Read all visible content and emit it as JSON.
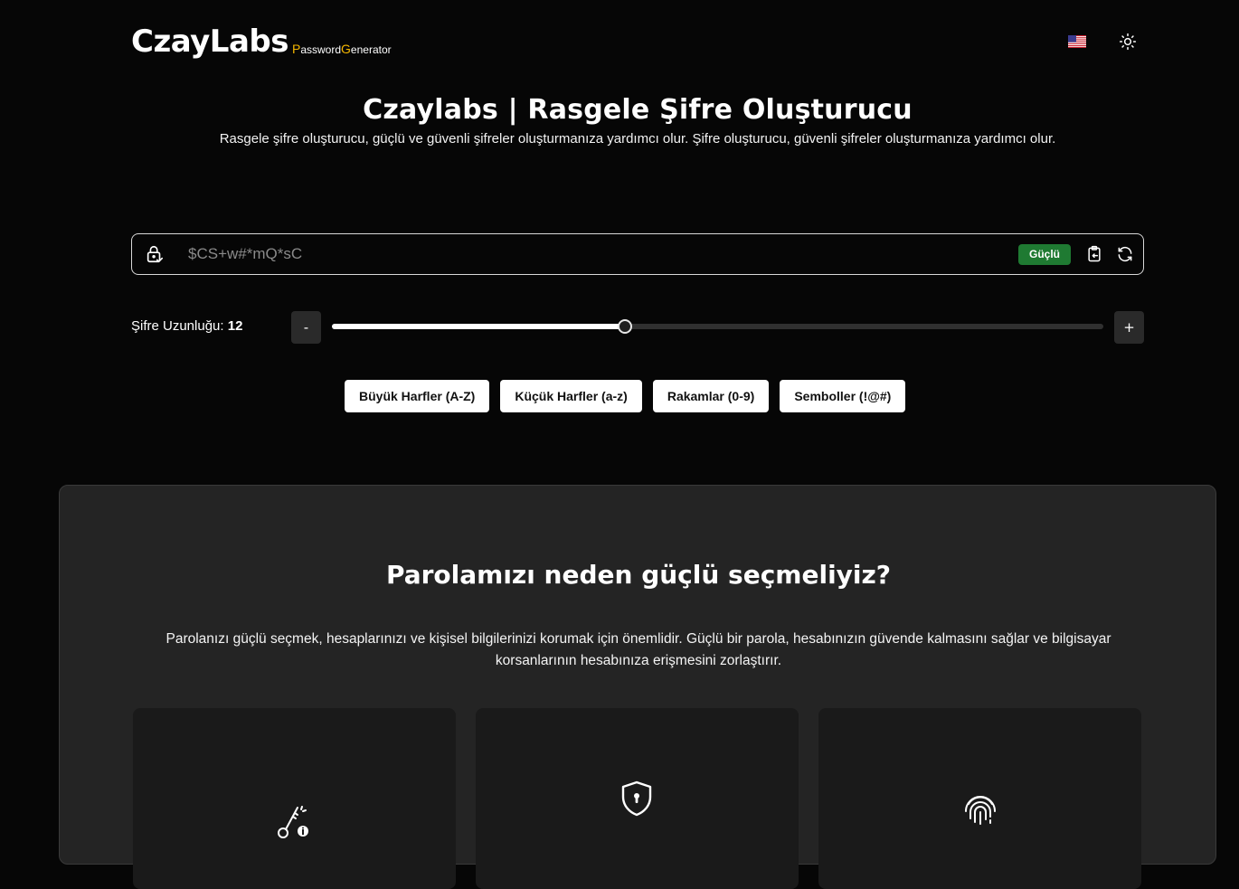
{
  "header": {
    "logo_main": "CzayLabs",
    "logo_sub_p": "P",
    "logo_sub_1": "assword",
    "logo_sub_g": "G",
    "logo_sub_2": "enerator",
    "language_icon": "us-flag-icon",
    "theme_icon": "sun-icon"
  },
  "hero": {
    "title": "Czaylabs | Rasgele Şifre Oluşturucu",
    "subtitle": "Rasgele şifre oluşturucu, güçlü ve güvenli şifreler oluşturmanıza yardımcı olur. Şifre oluşturucu, güvenli şifreler oluşturmanıza yardımcı olur."
  },
  "password": {
    "value": "$CS+w#*mQ*sC",
    "strength": "Güçlü",
    "strength_color": "#1f7a32"
  },
  "length": {
    "label": "Şifre Uzunluğu:",
    "value": "12",
    "minus": "-",
    "plus": "+",
    "slider_fraction": 0.38
  },
  "options": [
    {
      "label": "Büyük Harfler (A-Z)"
    },
    {
      "label": "Küçük Harfler (a-z)"
    },
    {
      "label": "Rakamlar (0-9)"
    },
    {
      "label": "Semboller (!@#)"
    }
  ],
  "info": {
    "title": "Parolamızı neden güçlü seçmeliyiz?",
    "text": "Parolanızı güçlü seçmek, hesaplarınızı ve kişisel bilgilerinizi korumak için önemlidir. Güçlü bir parola, hesabınızın güvende kalmasını sağlar ve bilgisayar korsanlarının hesabınıza erişmesini zorlaştırır.",
    "cards": [
      {
        "icon": "key-icon"
      },
      {
        "icon": "shield-lock-icon"
      },
      {
        "icon": "fingerprint-icon"
      }
    ]
  },
  "colors": {
    "accent": "#f5b700",
    "background": "#060606",
    "panel": "#242424"
  }
}
